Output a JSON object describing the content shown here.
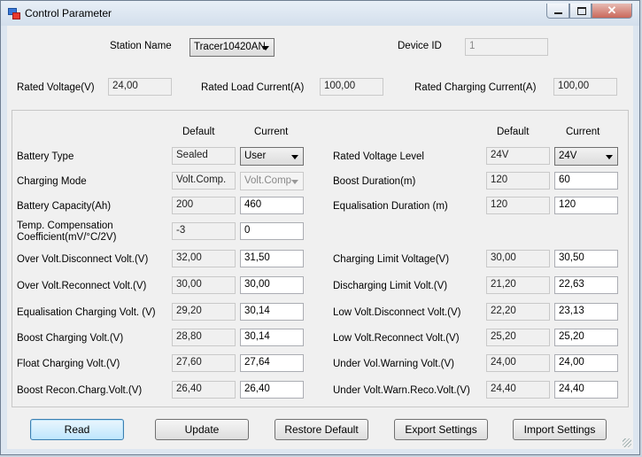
{
  "window": {
    "title": "Control Parameter"
  },
  "header": {
    "station_name_label": "Station Name",
    "station_name_value": "Tracer10420AN",
    "device_id_label": "Device ID",
    "device_id_value": "1"
  },
  "rated": {
    "voltage_label": "Rated Voltage(V)",
    "voltage_value": "24,00",
    "load_current_label": "Rated Load Current(A)",
    "load_current_value": "100,00",
    "charging_current_label": "Rated Charging Current(A)",
    "charging_current_value": "100,00"
  },
  "columns": {
    "default": "Default",
    "current": "Current"
  },
  "left": [
    {
      "label": "Battery Type",
      "default": "Sealed",
      "current": "User"
    },
    {
      "label": "Charging Mode",
      "default": "Volt.Comp.",
      "current": "Volt.Comp"
    },
    {
      "label": "Battery Capacity(Ah)",
      "default": "200",
      "current": "460"
    },
    {
      "label_line1": "Temp. Compensation",
      "label_line2": "Coefficient(mV/°C/2V)",
      "default": "-3",
      "current": "0"
    },
    {
      "label": "Over Volt.Disconnect Volt.(V)",
      "default": "32,00",
      "current": "31,50"
    },
    {
      "label": "Over Volt.Reconnect Volt.(V)",
      "default": "30,00",
      "current": "30,00"
    },
    {
      "label": "Equalisation Charging Volt. (V)",
      "default": "29,20",
      "current": "30,14"
    },
    {
      "label": "Boost Charging Volt.(V)",
      "default": "28,80",
      "current": "30,14"
    },
    {
      "label": "Float Charging Volt.(V)",
      "default": "27,60",
      "current": "27,64"
    },
    {
      "label": "Boost Recon.Charg.Volt.(V)",
      "default": "26,40",
      "current": "26,40"
    }
  ],
  "right": [
    {
      "label": "Rated Voltage Level",
      "default": "24V",
      "current": "24V"
    },
    {
      "label": "Boost Duration(m)",
      "default": "120",
      "current": "60"
    },
    {
      "label": "Equalisation Duration (m)",
      "default": "120",
      "current": "120"
    },
    {
      "label": "Charging Limit Voltage(V)",
      "default": "30,00",
      "current": "30,50"
    },
    {
      "label": "Discharging Limit Volt.(V)",
      "default": "21,20",
      "current": "22,63"
    },
    {
      "label": "Low Volt.Disconnect Volt.(V)",
      "default": "22,20",
      "current": "23,13"
    },
    {
      "label": "Low Volt.Reconnect Volt.(V)",
      "default": "25,20",
      "current": "25,20"
    },
    {
      "label": "Under Vol.Warning Volt.(V)",
      "default": "24,00",
      "current": "24,00"
    },
    {
      "label": "Under Volt.Warn.Reco.Volt.(V)",
      "default": "24,40",
      "current": "24,40"
    }
  ],
  "buttons": {
    "read": "Read",
    "update": "Update",
    "restore_default": "Restore Default",
    "export_settings": "Export Settings",
    "import_settings": "Import Settings"
  },
  "icons": {
    "window_icon": "app-icon",
    "minimize": "minimize-icon",
    "maximize": "maximize-icon",
    "close": "close-icon"
  }
}
